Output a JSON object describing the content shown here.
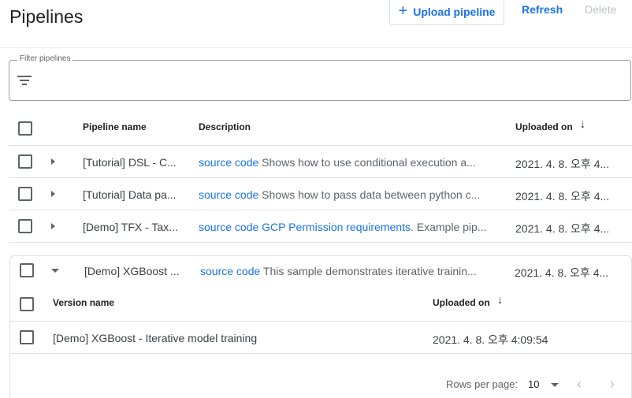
{
  "header": {
    "title": "Pipelines",
    "upload_label": "Upload pipeline",
    "refresh_label": "Refresh",
    "delete_label": "Delete"
  },
  "filter": {
    "label": "Filter pipelines",
    "value": ""
  },
  "table": {
    "columns": {
      "name": "Pipeline name",
      "description": "Description",
      "uploaded": "Uploaded on"
    },
    "rows": [
      {
        "name": "[Tutorial] DSL - C...",
        "link1": "source code",
        "link2": "",
        "desc": " Shows how to use conditional execution a...",
        "uploaded": "2021. 4. 8. 오후 4...",
        "expanded": false
      },
      {
        "name": "[Tutorial] Data pa...",
        "link1": "source code",
        "link2": "",
        "desc": " Shows how to pass data between python c...",
        "uploaded": "2021. 4. 8. 오후 4...",
        "expanded": false
      },
      {
        "name": "[Demo] TFX - Tax...",
        "link1": "source code",
        "link2": "GCP Permission requirements",
        "desc": ". Example pip...",
        "uploaded": "2021. 4. 8. 오후 4...",
        "expanded": false
      },
      {
        "name": "[Demo] XGBoost ...",
        "link1": "source code",
        "link2": "",
        "desc": " This sample demonstrates iterative trainin...",
        "uploaded": "2021. 4. 8. 오후 4...",
        "expanded": true
      }
    ]
  },
  "versions": {
    "columns": {
      "name": "Version name",
      "uploaded": "Uploaded on"
    },
    "rows": [
      {
        "name": "[Demo] XGBoost - Iterative model training",
        "uploaded": "2021. 4. 8. 오후 4:09:54"
      }
    ],
    "footer": {
      "rows_per_page_label": "Rows per page:",
      "rows_per_page_value": "10"
    }
  },
  "icons": {
    "sort": "arrow-down-icon",
    "filter": "filter-list-icon",
    "prev": "chevron-left-icon",
    "next": "chevron-right-icon",
    "dropdown": "caret-down-icon"
  },
  "colors": {
    "accent": "#1a73e8",
    "disabled": "#bdc1c6"
  }
}
